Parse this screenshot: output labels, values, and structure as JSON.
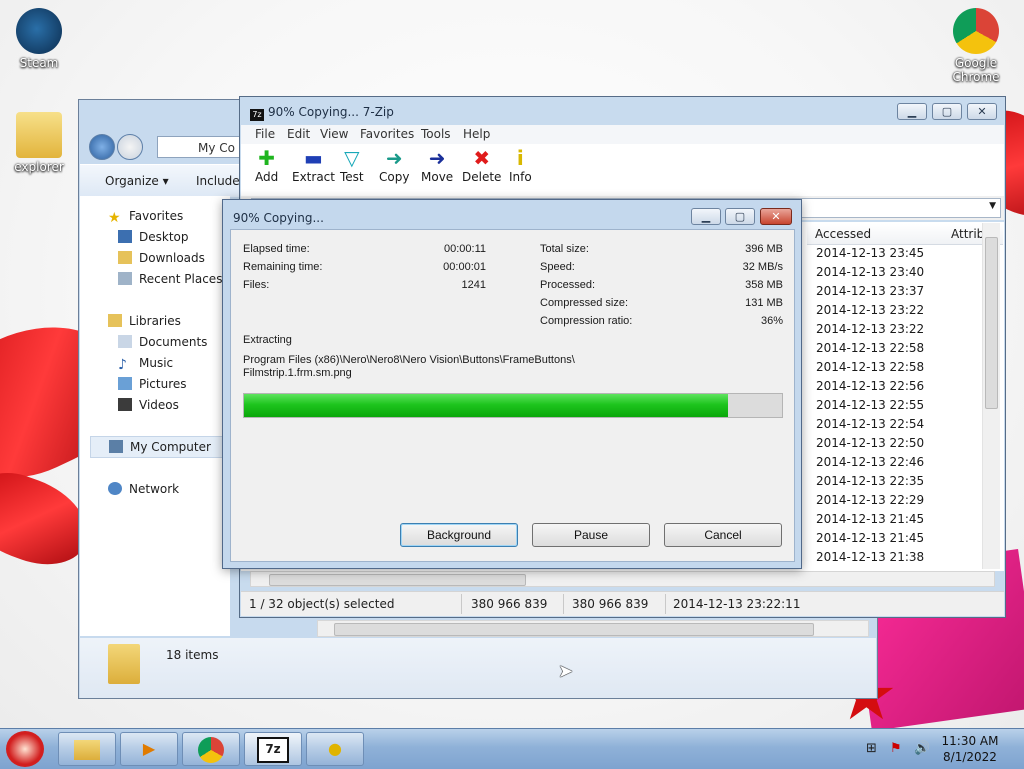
{
  "desktop": {
    "icons": [
      {
        "label": "Steam"
      },
      {
        "label": "explorer"
      },
      {
        "label": "Google Chrome"
      }
    ]
  },
  "explorer": {
    "address_text": "My Co",
    "toolbar": {
      "organize": "Organize ▾",
      "include": "Include i"
    },
    "nav": {
      "favorites": "Favorites",
      "desktop": "Desktop",
      "downloads": "Downloads",
      "recent": "Recent Places",
      "libraries": "Libraries",
      "documents": "Documents",
      "music": "Music",
      "pictures": "Pictures",
      "videos": "Videos",
      "computer": "My Computer",
      "network": "Network"
    },
    "status_items": "18 items"
  },
  "zip_window": {
    "title": "90% Copying... 7-Zip",
    "menu": [
      "File",
      "Edit",
      "View",
      "Favorites",
      "Tools",
      "Help"
    ],
    "tools": [
      {
        "label": "Add",
        "icon": "add-icon",
        "color": "#1fb51f"
      },
      {
        "label": "Extract",
        "icon": "extract-icon",
        "color": "#1f3fb5"
      },
      {
        "label": "Test",
        "icon": "test-icon",
        "color": "#19a8b8"
      },
      {
        "label": "Copy",
        "icon": "copy-icon",
        "color": "#1a9a8a"
      },
      {
        "label": "Move",
        "icon": "move-icon",
        "color": "#1a2f9a"
      },
      {
        "label": "Delete",
        "icon": "delete-icon",
        "color": "#e01b1b"
      },
      {
        "label": "Info",
        "icon": "info-icon",
        "color": "#d8b800"
      }
    ],
    "columns": {
      "accessed": "Accessed",
      "attrib": "Attrib"
    },
    "accessed_rows": [
      "2014-12-13 23:45",
      "2014-12-13 23:40",
      "2014-12-13 23:37",
      "2014-12-13 23:22",
      "2014-12-13 23:22",
      "2014-12-13 22:58",
      "2014-12-13 22:58",
      "2014-12-13 22:56",
      "2014-12-13 22:55",
      "2014-12-13 22:54",
      "2014-12-13 22:50",
      "2014-12-13 22:46",
      "2014-12-13 22:35",
      "2014-12-13 22:29",
      "2014-12-13 21:45",
      "2014-12-13 21:45",
      "2014-12-13 21:38"
    ],
    "status": {
      "selected": "1 / 32 object(s) selected",
      "size": "380 966 839",
      "packed": "380 966 839",
      "modified": "2014-12-13 23:22:11"
    }
  },
  "progress_dialog": {
    "title": "90% Copying...",
    "elapsed_label": "Elapsed time:",
    "elapsed": "00:00:11",
    "remaining_label": "Remaining time:",
    "remaining": "00:00:01",
    "files_label": "Files:",
    "files": "1241",
    "total_label": "Total size:",
    "total": "396 MB",
    "speed_label": "Speed:",
    "speed": "32 MB/s",
    "processed_label": "Processed:",
    "processed": "358 MB",
    "compressed_label": "Compressed size:",
    "compressed": "131 MB",
    "ratio_label": "Compression ratio:",
    "ratio": "36%",
    "operation": "Extracting",
    "path_line1": "Program Files (x86)\\Nero\\Nero8\\Nero Vision\\Buttons\\FrameButtons\\",
    "path_line2": "Filmstrip.1.frm.sm.png",
    "progress_percent": 90,
    "buttons": {
      "background": "Background",
      "pause": "Pause",
      "cancel": "Cancel"
    }
  },
  "taskbar": {
    "clock_time": "11:30 AM",
    "clock_date": "8/1/2022",
    "apps": [
      "start",
      "explorer",
      "media-player",
      "chrome",
      "7-zip",
      "messenger"
    ]
  }
}
